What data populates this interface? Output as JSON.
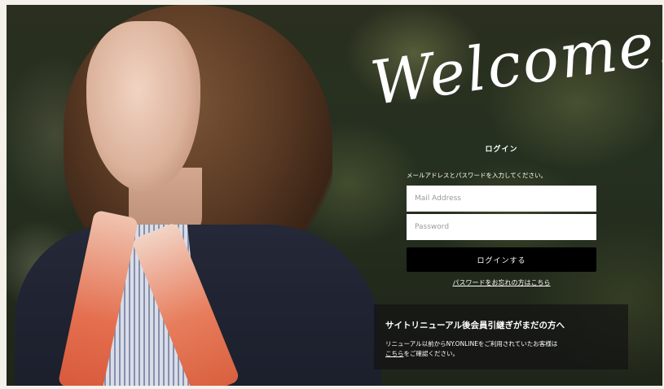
{
  "hero": {
    "welcome_text": "Welcome!"
  },
  "login": {
    "title": "ログイン",
    "instruction": "メールアドレスとパスワードを入力してください。",
    "email_placeholder": "Mail Address",
    "password_placeholder": "Password",
    "submit_label": "ログインする",
    "forgot_password_link": "パスワードをお忘れの方はこちら"
  },
  "notice": {
    "title": "サイトリニューアル後会員引継ぎがまだの方へ",
    "line1": "リニューアル以前からNY.ONLINEをご利用されていたお客様は",
    "link_text": "こちら",
    "line2_suffix": "をご確認ください。"
  },
  "colors": {
    "button_bg": "#000000",
    "text": "#ffffff",
    "panel_bg": "#141414"
  }
}
